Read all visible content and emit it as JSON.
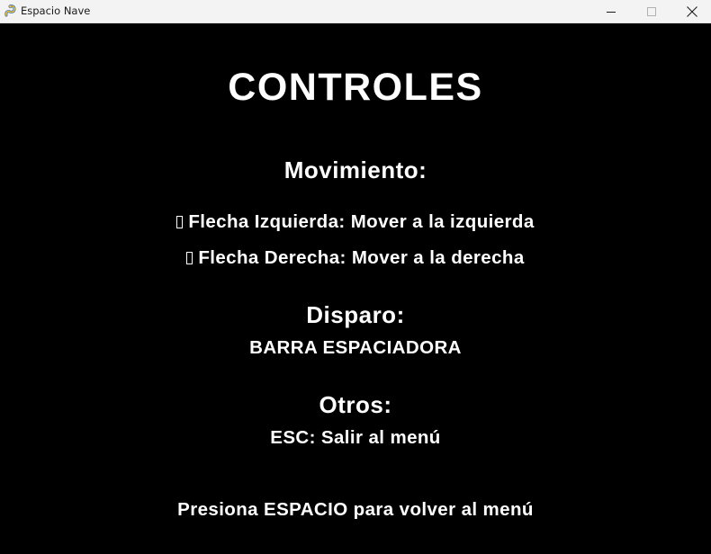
{
  "window": {
    "title": "Espacio Nave",
    "icon": "pygame-snake-icon",
    "controls": [
      "minimize-icon",
      "maximize-icon",
      "close-icon"
    ]
  },
  "screen": {
    "heading": "CONTROLES",
    "movement": {
      "label": "Movimiento:",
      "left": "Flecha Izquierda: Mover a la izquierda",
      "right": "Flecha Derecha: Mover a la derecha",
      "arrow_glyph": "missing-glyph-box-icon"
    },
    "shoot": {
      "label": "Disparo:",
      "key": "BARRA ESPACIADORA"
    },
    "other": {
      "label": "Otros:",
      "esc": "ESC: Salir al menú"
    },
    "footer": "Presiona ESPACIO para volver al menú"
  },
  "colors": {
    "background": "#000000",
    "text": "#ffffff",
    "titlebar": "#f3f3f3"
  }
}
